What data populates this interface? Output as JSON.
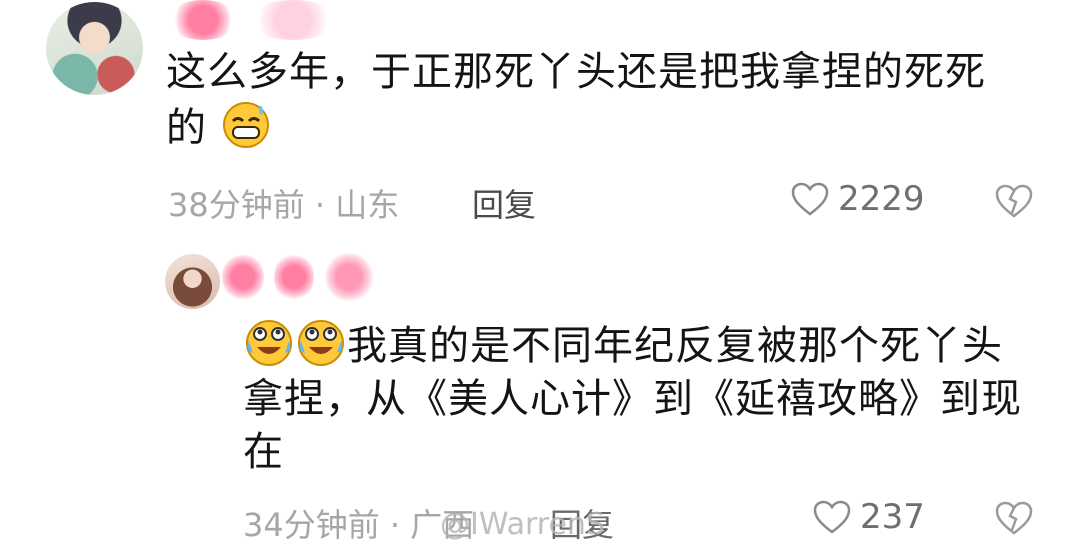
{
  "comments": [
    {
      "text_line1": "这么多年，于正那死丫头还是把我拿捏的死死",
      "text_line2": "的",
      "emoji_after": "grinning-sweat-emoji",
      "time": "38分钟前",
      "location": "山东",
      "reply_label": "回复",
      "likes": "2229"
    },
    {
      "emojis_before": [
        "tearful-laugh-emoji",
        "tearful-laugh-emoji"
      ],
      "text_line1": "我真的是不同年纪反复被那个死丫头",
      "text_line2": "拿捏，从《美人心计》到《延禧攻略》到现",
      "text_line3": "在",
      "time": "34分钟前",
      "location": "广西",
      "reply_label": "回复",
      "likes": "237"
    }
  ],
  "watermark": "@IWarrenS",
  "icons": {
    "like": "heart-outline-icon",
    "dislike": "broken-heart-icon"
  }
}
